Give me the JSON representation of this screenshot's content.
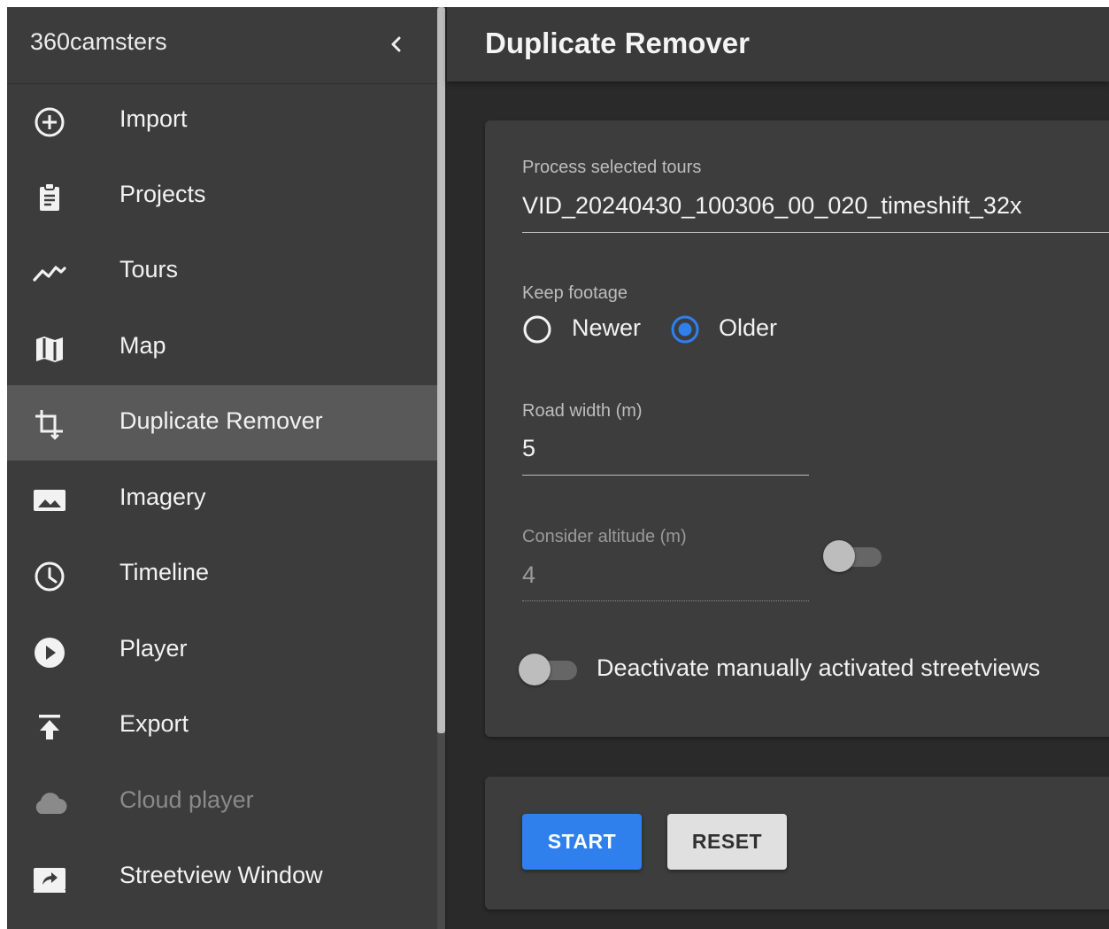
{
  "sidebar": {
    "title": "360camsters",
    "items": [
      {
        "label": "Import",
        "icon": "add-circle-icon",
        "active": false,
        "disabled": false
      },
      {
        "label": "Projects",
        "icon": "clipboard-icon",
        "active": false,
        "disabled": false
      },
      {
        "label": "Tours",
        "icon": "trending-line-icon",
        "active": false,
        "disabled": false
      },
      {
        "label": "Map",
        "icon": "map-icon",
        "active": false,
        "disabled": false
      },
      {
        "label": "Duplicate Remover",
        "icon": "crop-icon",
        "active": true,
        "disabled": false
      },
      {
        "label": "Imagery",
        "icon": "image-icon",
        "active": false,
        "disabled": false
      },
      {
        "label": "Timeline",
        "icon": "clock-icon",
        "active": false,
        "disabled": false
      },
      {
        "label": "Player",
        "icon": "play-circle-icon",
        "active": false,
        "disabled": false
      },
      {
        "label": "Export",
        "icon": "upload-icon",
        "active": false,
        "disabled": false
      },
      {
        "label": "Cloud player",
        "icon": "cloud-icon",
        "active": false,
        "disabled": true
      },
      {
        "label": "Streetview Window",
        "icon": "open-in-window-icon",
        "active": false,
        "disabled": false
      }
    ]
  },
  "header": {
    "title": "Duplicate Remover"
  },
  "form": {
    "tours": {
      "label": "Process selected tours",
      "value": "VID_20240430_100306_00_020_timeshift_32x"
    },
    "keep_footage": {
      "label": "Keep footage",
      "options": [
        {
          "label": "Newer",
          "selected": false
        },
        {
          "label": "Older",
          "selected": true
        }
      ]
    },
    "road_width": {
      "label": "Road width (m)",
      "value": "5"
    },
    "altitude": {
      "label": "Consider altitude (m)",
      "value": "4",
      "enabled": false
    },
    "deactivate": {
      "label": "Deactivate manually activated streetviews",
      "on": false
    }
  },
  "actions": {
    "start_label": "START",
    "reset_label": "RESET"
  },
  "colors": {
    "accent": "#2f80ed",
    "active_item": "#595959",
    "sidebar_bg": "#3c3c3c",
    "card_bg": "#3d3d3d"
  }
}
